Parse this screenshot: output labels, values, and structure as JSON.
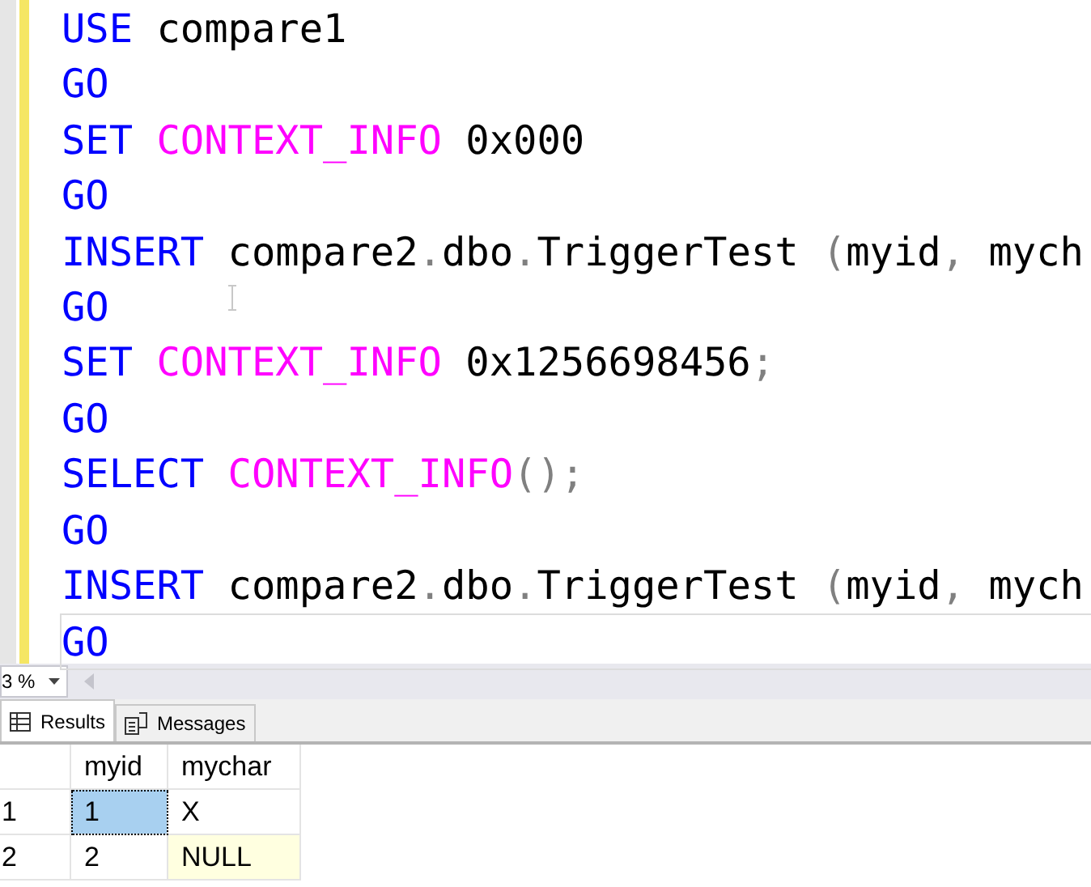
{
  "editor": {
    "lines": [
      {
        "current": false,
        "tokens": [
          {
            "kind": "keyword",
            "text": "USE"
          },
          {
            "kind": "plain",
            "text": " compare1"
          }
        ]
      },
      {
        "current": false,
        "tokens": [
          {
            "kind": "keyword",
            "text": "GO"
          }
        ]
      },
      {
        "current": false,
        "tokens": [
          {
            "kind": "keyword",
            "text": "SET"
          },
          {
            "kind": "function",
            "text": " CONTEXT_INFO"
          },
          {
            "kind": "plain",
            "text": " 0x000"
          }
        ]
      },
      {
        "current": false,
        "tokens": [
          {
            "kind": "keyword",
            "text": "GO"
          }
        ]
      },
      {
        "current": false,
        "tokens": [
          {
            "kind": "keyword",
            "text": "INSERT"
          },
          {
            "kind": "plain",
            "text": " compare2"
          },
          {
            "kind": "punct",
            "text": "."
          },
          {
            "kind": "plain",
            "text": "dbo"
          },
          {
            "kind": "punct",
            "text": "."
          },
          {
            "kind": "plain",
            "text": "TriggerTest "
          },
          {
            "kind": "punct",
            "text": "("
          },
          {
            "kind": "plain",
            "text": "myid"
          },
          {
            "kind": "punct",
            "text": ","
          },
          {
            "kind": "plain",
            "text": " mych"
          }
        ]
      },
      {
        "current": false,
        "tokens": [
          {
            "kind": "keyword",
            "text": "GO"
          }
        ]
      },
      {
        "current": false,
        "tokens": [
          {
            "kind": "keyword",
            "text": "SET"
          },
          {
            "kind": "function",
            "text": " CONTEXT_INFO"
          },
          {
            "kind": "plain",
            "text": " 0x1256698456"
          },
          {
            "kind": "punct",
            "text": ";"
          }
        ]
      },
      {
        "current": false,
        "tokens": [
          {
            "kind": "keyword",
            "text": "GO"
          }
        ]
      },
      {
        "current": false,
        "tokens": [
          {
            "kind": "keyword",
            "text": "SELECT"
          },
          {
            "kind": "function",
            "text": " CONTEXT_INFO"
          },
          {
            "kind": "punct",
            "text": "();"
          }
        ]
      },
      {
        "current": false,
        "tokens": [
          {
            "kind": "keyword",
            "text": "GO"
          }
        ]
      },
      {
        "current": false,
        "tokens": [
          {
            "kind": "keyword",
            "text": "INSERT"
          },
          {
            "kind": "plain",
            "text": " compare2"
          },
          {
            "kind": "punct",
            "text": "."
          },
          {
            "kind": "plain",
            "text": "dbo"
          },
          {
            "kind": "punct",
            "text": "."
          },
          {
            "kind": "plain",
            "text": "TriggerTest "
          },
          {
            "kind": "punct",
            "text": "("
          },
          {
            "kind": "plain",
            "text": "myid"
          },
          {
            "kind": "punct",
            "text": ","
          },
          {
            "kind": "plain",
            "text": " mych"
          }
        ]
      },
      {
        "current": true,
        "tokens": [
          {
            "kind": "keyword",
            "text": "GO"
          }
        ]
      }
    ]
  },
  "zoom": {
    "value": "3 %"
  },
  "result_tabs": [
    {
      "label": "Results",
      "selected": true
    },
    {
      "label": "Messages",
      "selected": false
    }
  ],
  "grid": {
    "columns": [
      "myid",
      "mychar"
    ],
    "rows": [
      {
        "number": "1",
        "cells": [
          {
            "text": "1",
            "selected": true,
            "is_null": false
          },
          {
            "text": "X",
            "selected": false,
            "is_null": false
          }
        ]
      },
      {
        "number": "2",
        "cells": [
          {
            "text": "2",
            "selected": false,
            "is_null": false
          },
          {
            "text": "NULL",
            "selected": false,
            "is_null": true
          }
        ]
      }
    ]
  }
}
